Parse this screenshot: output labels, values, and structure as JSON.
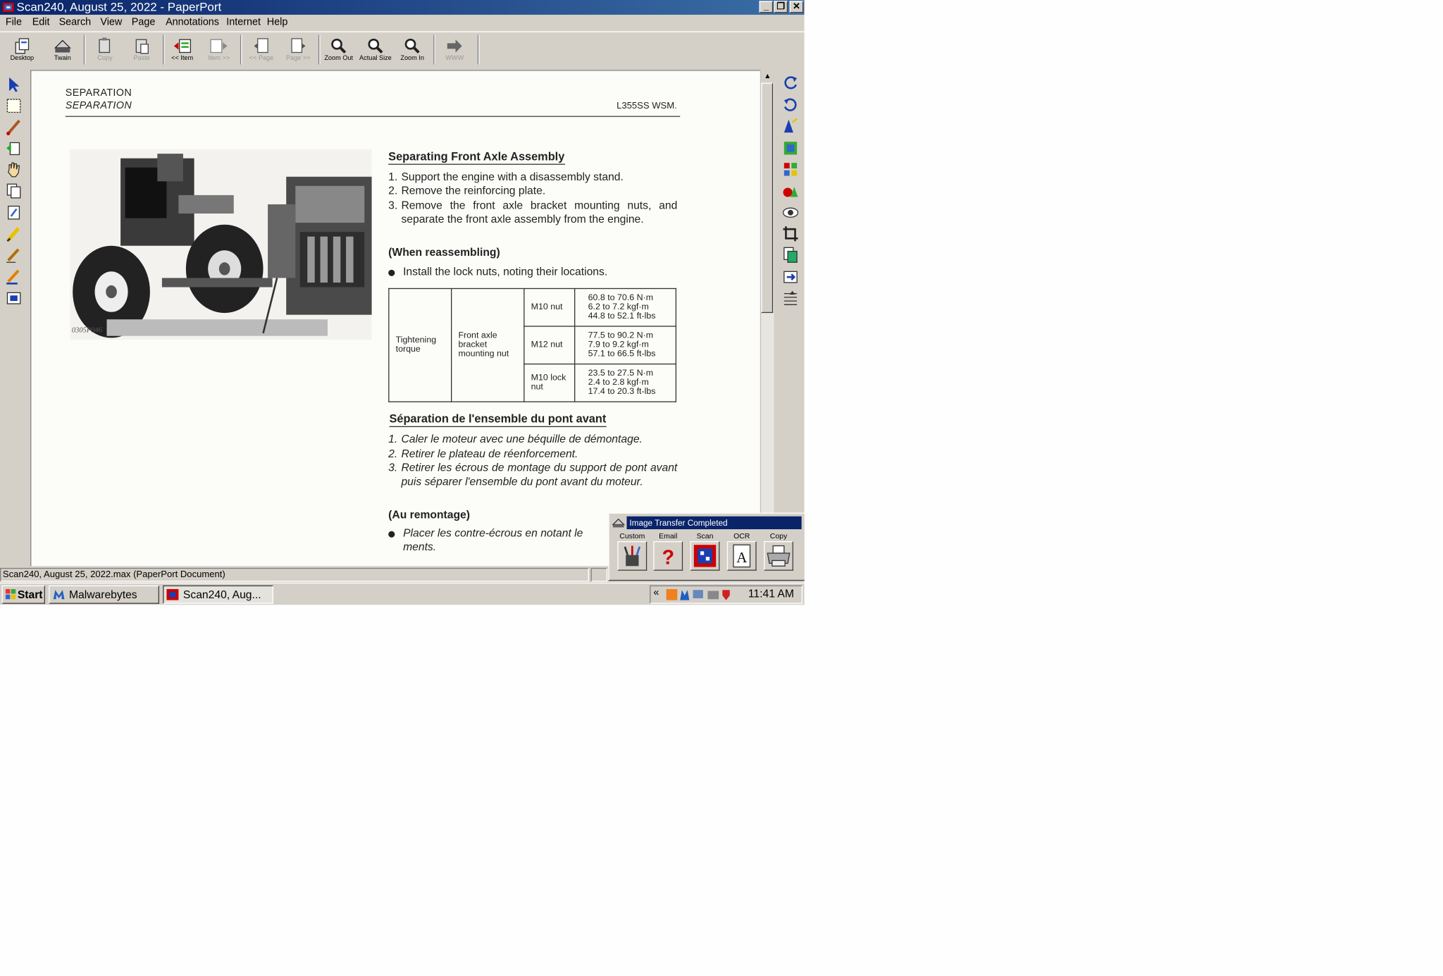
{
  "window": {
    "title": "Scan240, August 25, 2022 - PaperPort"
  },
  "menu": [
    "File",
    "Edit",
    "Search",
    "View",
    "Page",
    "Annotations",
    "Internet",
    "Help"
  ],
  "toolbar": {
    "desktop": "Desktop",
    "twain": "Twain",
    "copy": "Copy",
    "paste": "Paste",
    "prev_item": "<< Item",
    "next_item": "Item >>",
    "prev_page": "<< Page",
    "next_page": "Page >>",
    "zoom_out": "Zoom Out",
    "actual_size": "Actual Size",
    "zoom_in": "Zoom In",
    "www": "WWW"
  },
  "document": {
    "header_en": "SEPARATION",
    "header_fr": "SEPARATION",
    "model": "L355SS  WSM.",
    "photo_caption": "0305P046",
    "en": {
      "heading": "Separating Front Axle Assembly",
      "steps": [
        {
          "n": "1.",
          "t": "Support the engine with a disassembly stand."
        },
        {
          "n": "2.",
          "t": "Remove the reinforcing plate."
        },
        {
          "n": "3.",
          "t": "Remove the front axle bracket mounting nuts, and separate the front axle assembly from the engine."
        }
      ],
      "reassembly_heading": "(When reassembling)",
      "reassembly_bullet": "Install the lock nuts, noting their locations."
    },
    "table": {
      "col1": "Tightening torque",
      "col2": "Front axle bracket mounting nut",
      "rows": [
        {
          "size": "M10 nut",
          "v1": "60.8 to 70.6 N·m",
          "v2": "6.2 to 7.2 kgf·m",
          "v3": "44.8 to 52.1 ft-lbs"
        },
        {
          "size": "M12 nut",
          "v1": "77.5 to 90.2 N·m",
          "v2": "7.9 to 9.2 kgf·m",
          "v3": "57.1 to 66.5 ft-lbs"
        },
        {
          "size": "M10 lock nut",
          "v1": "23.5 to 27.5 N·m",
          "v2": "2.4 to 2.8 kgf·m",
          "v3": "17.4 to 20.3 ft-lbs"
        }
      ]
    },
    "fr": {
      "heading": "Séparation de l'ensemble du pont avant",
      "steps": [
        {
          "n": "1.",
          "t": "Caler le moteur avec une béquille de démontage."
        },
        {
          "n": "2.",
          "t": "Retirer le plateau de réenforcement."
        },
        {
          "n": "3.",
          "t": "Retirer les écrous de montage du support de pont avant puis séparer l'ensemble du pont avant du moteur."
        }
      ],
      "reassembly_heading": "(Au remontage)",
      "reassembly_bullet": "Placer les contre-écrous en notant leurs emplacements.",
      "reassembly_bullet_visible": "Placer les contre-écrous en notant le",
      "reassembly_bullet_line2": "ments."
    }
  },
  "status": {
    "text": "Scan240, August 25, 2022.max (PaperPort Document)"
  },
  "popup": {
    "title": "Image Transfer Completed",
    "buttons": [
      "Custom",
      "Email",
      "Scan",
      "OCR",
      "Copy"
    ]
  },
  "taskbar": {
    "start": "Start",
    "tasks": [
      "Malwarebytes",
      "Scan240, Aug..."
    ],
    "tray_expand": "«",
    "clock": "11:41 AM"
  },
  "colors": {
    "title_bar": "#0a246a",
    "chrome": "#d4d0c8"
  }
}
